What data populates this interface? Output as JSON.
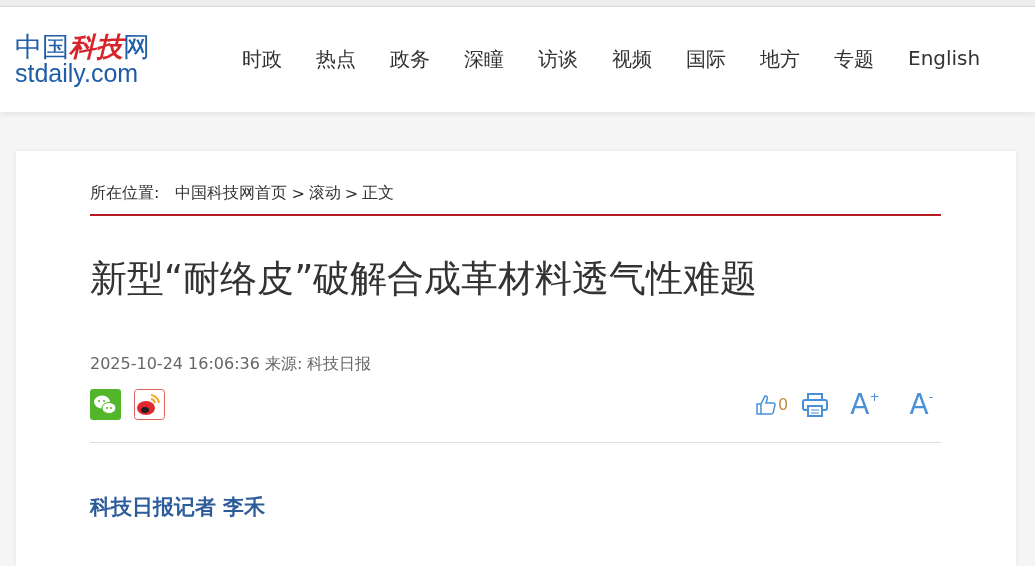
{
  "logo": {
    "parts": [
      {
        "text": "中国",
        "kind": "plain"
      },
      {
        "text": "科技",
        "kind": "accent"
      },
      {
        "text": "网",
        "kind": "plain"
      }
    ],
    "domain": "stdaily.com"
  },
  "nav": [
    "时政",
    "热点",
    "政务",
    "深瞳",
    "访谈",
    "视频",
    "国际",
    "地方",
    "专题",
    "English"
  ],
  "breadcrumb": {
    "label": "所在位置:",
    "links": [
      "中国科技网首页",
      "滚动",
      "正文"
    ],
    "separator": ">"
  },
  "article": {
    "title": "新型“耐络皮”破解合成革材料透气性难题",
    "meta": "2025-10-24 16:06:36 来源: 科技日报",
    "likes": "0",
    "font_up": {
      "letter": "A",
      "sign": "+"
    },
    "font_down": {
      "letter": "A",
      "sign": "-"
    },
    "byline": "科技日报记者 李禾"
  }
}
